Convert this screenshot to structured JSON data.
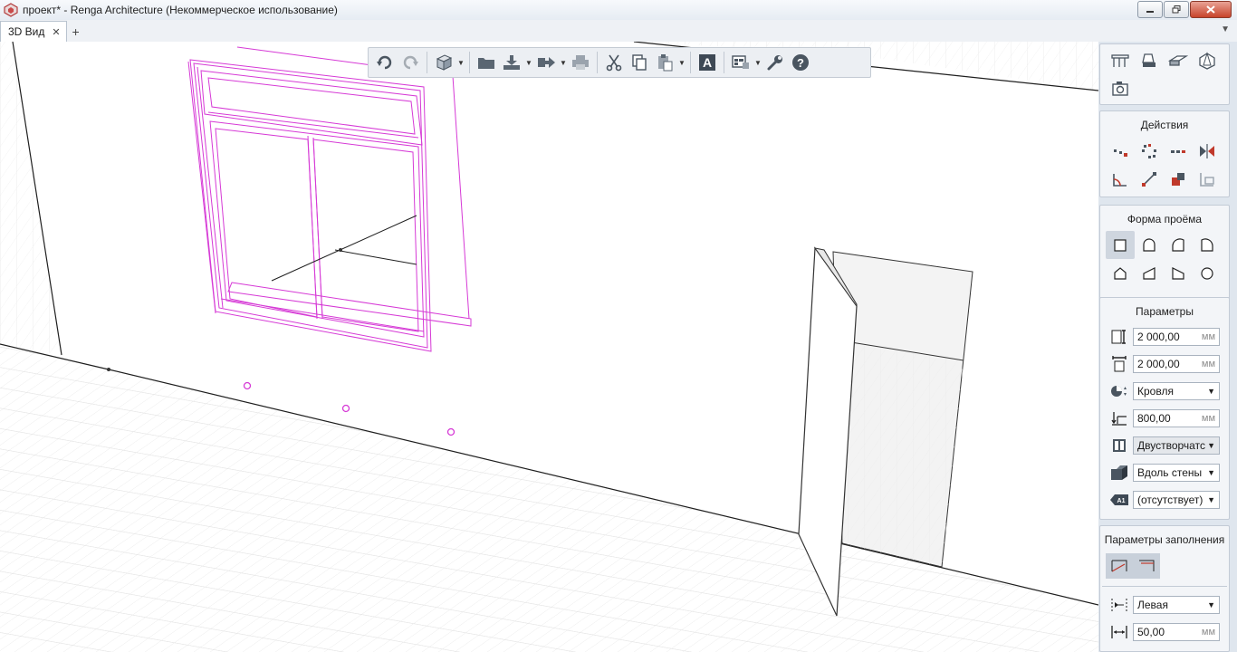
{
  "window": {
    "title": "проект* - Renga Architecture (Некоммерческое использование)",
    "controls": [
      "minimize-icon",
      "maximize-icon",
      "close-icon"
    ]
  },
  "tabs": [
    {
      "label": "3D Вид",
      "close": "✕",
      "active": true
    }
  ],
  "tab_add_label": "+",
  "tab_menu_glyph": "▼",
  "toolbar": {
    "buttons": [
      "undo-icon",
      "redo-icon",
      "view-cube-icon",
      "open-folder-icon",
      "import-icon",
      "export-icon",
      "print-icon",
      "cut-icon",
      "copy-icon",
      "paste-icon",
      "text-style-icon",
      "layers-icon",
      "settings-wrench-icon",
      "help-icon"
    ],
    "help_label": "?",
    "text_label": "A"
  },
  "panel": {
    "objects_icons": [
      "wall-tool-icon",
      "bucket-tool-icon",
      "opening-tool-icon",
      "shape-tool-icon",
      "snapshot-tool-icon"
    ],
    "actions": {
      "title": "Действия",
      "icons": [
        "move-icon",
        "rotate-icon",
        "array-icon",
        "mirror-icon",
        "angle-icon",
        "align-icon",
        "join-icon",
        "measure-icon"
      ]
    },
    "opening_shape": {
      "title": "Форма проёма",
      "icons": [
        "rect-shape-icon",
        "arch-shape-icon",
        "quarter-arch-left-icon",
        "quarter-arch-right-icon",
        "gable-shape-icon",
        "slope-left-icon",
        "slope-right-icon",
        "circle-shape-icon"
      ],
      "selected_index": 0
    },
    "parameters": {
      "title": "Параметры",
      "width": {
        "value": "2 000,00",
        "unit": "мм"
      },
      "height": {
        "value": "2 000,00",
        "unit": "мм"
      },
      "material": {
        "value": "Кровля"
      },
      "sill_offset": {
        "value": "800,00",
        "unit": "мм"
      },
      "fill_type": {
        "value": "Двустворчатс"
      },
      "alignment": {
        "value": "Вдоль стены"
      },
      "marker": {
        "value": "(отсутствует)"
      }
    },
    "fill_parameters": {
      "title": "Параметры заполнения",
      "side": {
        "value": "Левая"
      },
      "offset": {
        "value": "50,00",
        "unit": "мм"
      }
    }
  },
  "colors": {
    "selection": "#d63ad6",
    "panel_bg": "#dfe6ee",
    "grid": "#e2e2e2"
  }
}
